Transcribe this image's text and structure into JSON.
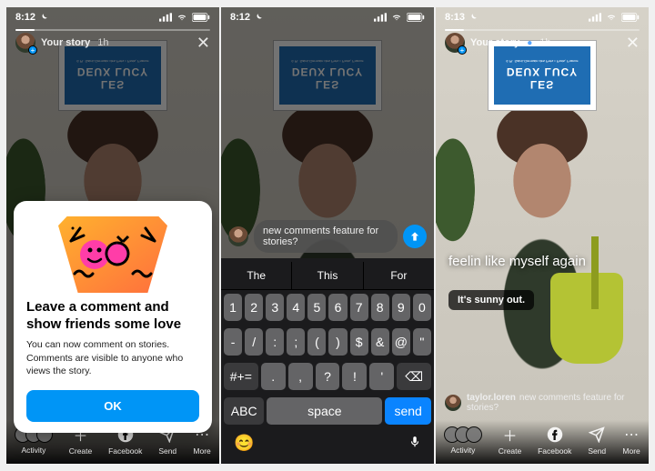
{
  "status": {
    "time1": "8:12",
    "time2": "8:12",
    "time3": "8:13"
  },
  "story": {
    "user": "Your story",
    "time": "1h",
    "close": "✕"
  },
  "poster": {
    "line1": "LES",
    "line2": "DEUX LUCY",
    "sub": "6 Pl. Saint-Germain des Prés • Paris, France"
  },
  "modal": {
    "title": "Leave a comment and show friends some love",
    "body": "You can now comment on stories. Comments are visible to anyone who views the story.",
    "ok": "OK"
  },
  "tray": {
    "activity": "Activity",
    "create": "Create",
    "facebook": "Facebook",
    "send": "Send",
    "more": "More"
  },
  "comment": {
    "text": "new comments feature for stories?"
  },
  "suggestions": {
    "a": "The",
    "b": "This",
    "c": "For"
  },
  "keys": {
    "num": [
      "1",
      "2",
      "3",
      "4",
      "5",
      "6",
      "7",
      "8",
      "9",
      "0"
    ],
    "sym": [
      "-",
      "/",
      ":",
      ";",
      "(",
      ")",
      "$",
      "&",
      "@",
      "\""
    ],
    "punc": [
      ".",
      ",",
      "?",
      "!",
      "'"
    ],
    "shift": "#+=",
    "back": "⌫",
    "abc": "ABC",
    "space": "space",
    "send": "send"
  },
  "screen3": {
    "caption": "feelin like myself again",
    "chip": "It's sunny out.",
    "commenter": "taylor.loren",
    "comment_text": "new comments feature for stories?"
  }
}
